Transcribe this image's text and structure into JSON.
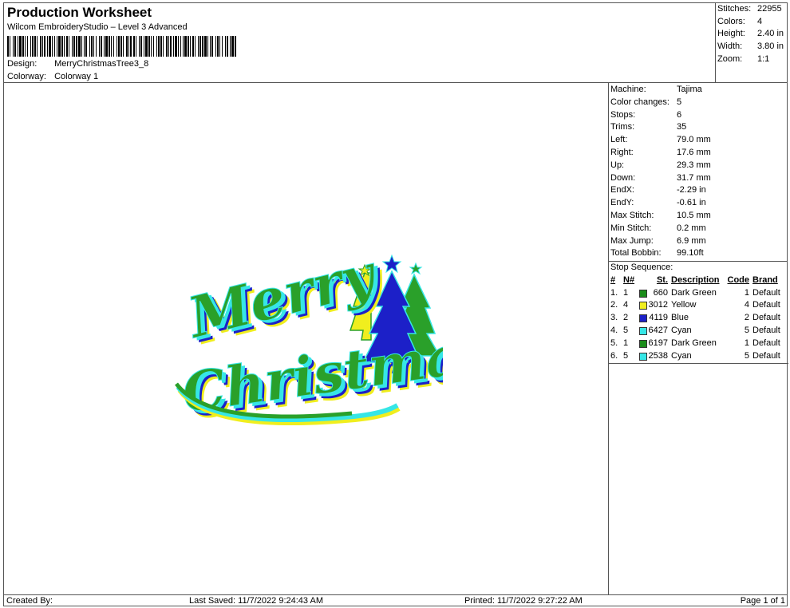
{
  "header": {
    "title": "Production Worksheet",
    "subtitle": "Wilcom EmbroideryStudio – Level 3 Advanced",
    "design_label": "Design:",
    "design_value": "MerryChristmasTree3_8",
    "colorway_label": "Colorway:",
    "colorway_value": "Colorway 1"
  },
  "summary": [
    {
      "label": "Stitches:",
      "value": "22955"
    },
    {
      "label": "Colors:",
      "value": "4"
    },
    {
      "label": "Height:",
      "value": "2.40 in"
    },
    {
      "label": "Width:",
      "value": "3.80 in"
    },
    {
      "label": "Zoom:",
      "value": "1:1"
    }
  ],
  "specs": [
    {
      "label": "Machine:",
      "value": "Tajima"
    },
    {
      "label": "Color changes:",
      "value": "5"
    },
    {
      "label": "Stops:",
      "value": "6"
    },
    {
      "label": "Trims:",
      "value": "35"
    },
    {
      "label": "Left:",
      "value": "79.0 mm"
    },
    {
      "label": "Right:",
      "value": "17.6 mm"
    },
    {
      "label": "Up:",
      "value": "29.3 mm"
    },
    {
      "label": "Down:",
      "value": "31.7 mm"
    },
    {
      "label": "EndX:",
      "value": "-2.29 in"
    },
    {
      "label": "EndY:",
      "value": "-0.61 in"
    },
    {
      "label": "Max Stitch:",
      "value": "10.5 mm"
    },
    {
      "label": "Min Stitch:",
      "value": "0.2 mm"
    },
    {
      "label": "Max Jump:",
      "value": "6.9 mm"
    },
    {
      "label": "Total Bobbin:",
      "value": "99.10ft"
    }
  ],
  "stop_sequence": {
    "title": "Stop Sequence:",
    "columns": {
      "num": "#",
      "n": "N#",
      "st": "St.",
      "description": "Description",
      "code": "Code",
      "brand": "Brand"
    },
    "rows": [
      {
        "num": "1.",
        "n": "1",
        "color": "#1a8c1a",
        "st": "660",
        "description": "Dark Green",
        "code": "1",
        "brand": "Default"
      },
      {
        "num": "2.",
        "n": "4",
        "color": "#f0ee1e",
        "st": "3012",
        "description": "Yellow",
        "code": "4",
        "brand": "Default"
      },
      {
        "num": "3.",
        "n": "2",
        "color": "#1c20c8",
        "st": "4119",
        "description": "Blue",
        "code": "2",
        "brand": "Default"
      },
      {
        "num": "4.",
        "n": "5",
        "color": "#36e6e6",
        "st": "6427",
        "description": "Cyan",
        "code": "5",
        "brand": "Default"
      },
      {
        "num": "5.",
        "n": "1",
        "color": "#1a8c1a",
        "st": "6197",
        "description": "Dark Green",
        "code": "1",
        "brand": "Default"
      },
      {
        "num": "6.",
        "n": "5",
        "color": "#36e6e6",
        "st": "2538",
        "description": "Cyan",
        "code": "5",
        "brand": "Default"
      }
    ]
  },
  "design_preview": {
    "line1": "Merry",
    "line2": "Christmas",
    "colors": {
      "green": "#2aa02a",
      "cyan": "#36e6e6",
      "blue": "#1c20c8",
      "yellow": "#f0ee1e"
    }
  },
  "footer": {
    "created_by": "Created By:",
    "last_saved": "Last Saved: 11/7/2022 9:24:43 AM",
    "printed": "Printed: 11/7/2022 9:27:22 AM",
    "page": "Page 1 of 1"
  }
}
